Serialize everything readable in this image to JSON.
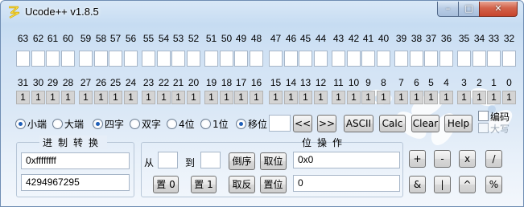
{
  "window": {
    "title": "Ucode++  v1.8.5",
    "controls": {
      "minimize": "–",
      "maximize": "□",
      "close": "✕"
    }
  },
  "hex_groups": [
    [
      "63",
      "62",
      "61",
      "60"
    ],
    [
      "59",
      "58",
      "57",
      "56"
    ],
    [
      "55",
      "54",
      "53",
      "52"
    ],
    [
      "51",
      "50",
      "49",
      "48"
    ],
    [
      "47",
      "46",
      "45",
      "44"
    ],
    [
      "43",
      "42",
      "41",
      "40"
    ],
    [
      "39",
      "38",
      "37",
      "36"
    ],
    [
      "35",
      "34",
      "33",
      "32"
    ]
  ],
  "bit_groups": [
    [
      "31",
      "30",
      "29",
      "28"
    ],
    [
      "27",
      "26",
      "25",
      "24"
    ],
    [
      "23",
      "22",
      "21",
      "20"
    ],
    [
      "19",
      "18",
      "17",
      "16"
    ],
    [
      "15",
      "14",
      "13",
      "12"
    ],
    [
      "11",
      "10",
      "9",
      "8"
    ],
    [
      "7",
      "6",
      "5",
      "4"
    ],
    [
      "3",
      "2",
      "1",
      "0"
    ]
  ],
  "bit_values": [
    [
      "1",
      "1",
      "1",
      "1"
    ],
    [
      "1",
      "1",
      "1",
      "1"
    ],
    [
      "1",
      "1",
      "1",
      "1"
    ],
    [
      "1",
      "1",
      "1",
      "1"
    ],
    [
      "1",
      "1",
      "1",
      "1"
    ],
    [
      "1",
      "1",
      "1",
      "1"
    ],
    [
      "1",
      "1",
      "1",
      "1"
    ],
    [
      "1",
      "1",
      "1",
      "1"
    ]
  ],
  "options": {
    "little_endian": "小端",
    "big_endian": "大端",
    "four_byte": "四字",
    "two_byte": "双字",
    "four_bit": "4位",
    "one_bit": "1位",
    "shift": "移位",
    "selected_endian": "little_endian",
    "selected_width": "four_byte",
    "shift_selected": true,
    "shift_value": ""
  },
  "toolbar": {
    "shift_left": "<<",
    "shift_right": ">>",
    "ascii": "ASCII",
    "calc": "Calc",
    "clear": "Clear",
    "help": "Help",
    "encoding": "编码",
    "uppercase": "大写"
  },
  "radix_panel": {
    "title": "进制转换",
    "hex_value": "0xffffffff",
    "dec_value": "4294967295"
  },
  "bit_ops": {
    "title": "位操作",
    "from_label": "从",
    "to_label": "到",
    "from_value": "",
    "to_value": "",
    "reverse": "倒序",
    "get_bit": "取位",
    "set0": "置 0",
    "set1": "置 1",
    "invert": "取反",
    "set_bit": "置位",
    "result_hex": "0x0",
    "result_dec": "0"
  },
  "operators": {
    "plus": "+",
    "minus": "-",
    "mul": "x",
    "div": "/",
    "and": "&",
    "or": "|",
    "xor": "^",
    "mod": "%"
  }
}
